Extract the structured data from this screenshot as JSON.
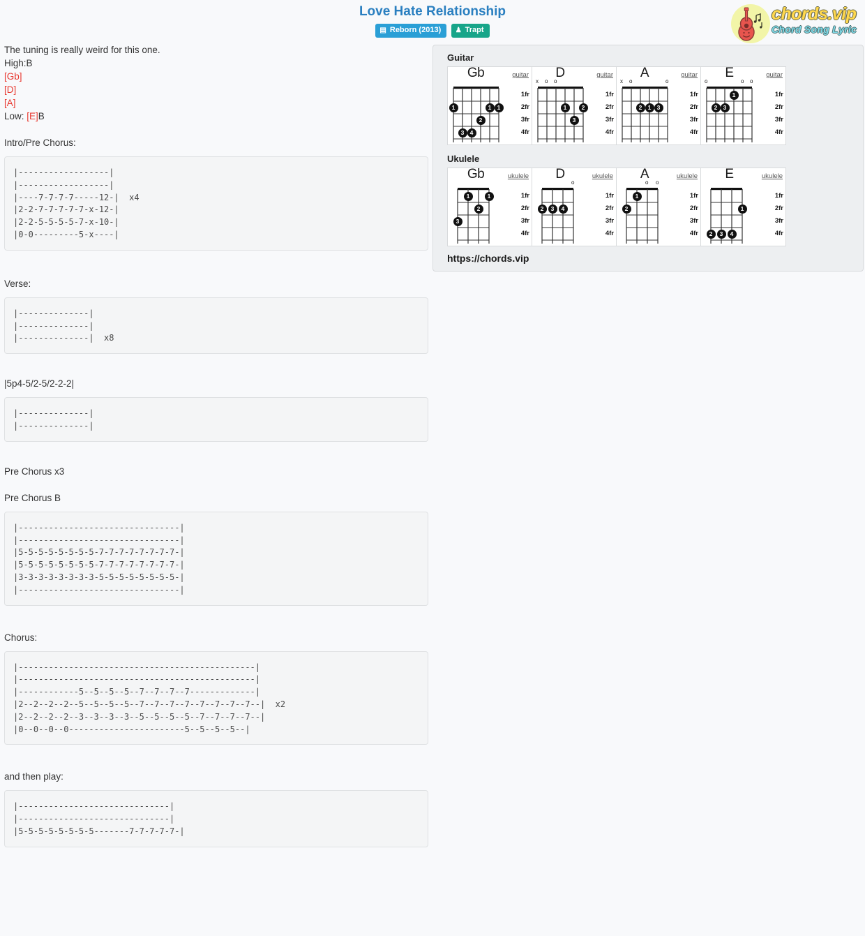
{
  "header": {
    "title": "Love Hate Relationship",
    "badges": [
      {
        "icon": "book-icon",
        "glyph": "▤",
        "label": "Reborn (2013)",
        "color": "#2a9fd6",
        "type": "album"
      },
      {
        "icon": "user-icon",
        "glyph": "♟",
        "label": "Trapt",
        "color": "#17a589",
        "type": "artist"
      }
    ]
  },
  "logo": {
    "icon": "guitar-icon",
    "main": "chords.vip",
    "sub": "Chord Song Lyric",
    "main_color": "#ffd84d",
    "sub_color": "#7fdcea",
    "disc_color": "#f2f5a8"
  },
  "body": {
    "intro_lines": [
      {
        "text": "The tuning is really weird for this one.",
        "chord": false
      },
      {
        "text": "High:B",
        "chord": false
      },
      {
        "text": "[Gb]",
        "chord": true
      },
      {
        "text": "[D]",
        "chord": true
      },
      {
        "text": "[A]",
        "chord": true
      },
      {
        "prefix": "Low: ",
        "chordpart": "[E]",
        "suffix": "B",
        "chord": "mixed"
      }
    ],
    "sections": [
      {
        "label": "Intro/Pre Chorus:",
        "tab": "|------------------|\n|------------------|\n|----7-7-7-7-----12-|  x4\n|2-2-7-7-7-7-7-x-12-|\n|2-2-5-5-5-5-7-x-10-|\n|0-0---------5-x----|"
      },
      {
        "label": "Verse:",
        "tab": "|--------------|\n|--------------|\n|--------------|  x8"
      },
      {
        "label": "|5p4-5/2-5/2-2-2|",
        "plain": true,
        "tab": "|--------------|\n|--------------|"
      },
      {
        "label": "Pre Chorus x3",
        "label2": "Pre Chorus B",
        "tab": "|--------------------------------|\n|--------------------------------|\n|5-5-5-5-5-5-5-5-7-7-7-7-7-7-7-7-|\n|5-5-5-5-5-5-5-5-7-7-7-7-7-7-7-7-|\n|3-3-3-3-3-3-3-3-5-5-5-5-5-5-5-5-|\n|--------------------------------|"
      },
      {
        "label": "Chorus:",
        "tab": "|-----------------------------------------------|\n|-----------------------------------------------|\n|------------5--5--5--5--7--7--7--7-------------|\n|2--2--2--2--5--5--5--5--7--7--7--7--7--7--7--7--|  x2\n|2--2--2--2--3--3--3--3--5--5--5--5--7--7--7--7--|\n|0--0--0--0-----------------------5--5--5--5--|"
      },
      {
        "label": "and then play:",
        "tab": "|------------------------------|\n|------------------------------|\n|5-5-5-5-5-5-5-5-------7-7-7-7-7-|"
      }
    ]
  },
  "chord_panel": {
    "guitar_title": "Guitar",
    "ukulele_title": "Ukulele",
    "site_link": "https://chords.vip",
    "fret_labels": [
      "1fr",
      "2fr",
      "3fr",
      "4fr"
    ],
    "guitar": [
      {
        "name": "Gb",
        "instrument": "guitar",
        "open": [],
        "muted": [],
        "dots": [
          {
            "string": 0,
            "fret": 2,
            "finger": "1"
          },
          {
            "string": 4,
            "fret": 2,
            "finger": "1"
          },
          {
            "string": 5,
            "fret": 2,
            "finger": "1"
          },
          {
            "string": 3,
            "fret": 3,
            "finger": "2"
          },
          {
            "string": 1,
            "fret": 4,
            "finger": "3"
          },
          {
            "string": 2,
            "fret": 4,
            "finger": "4"
          }
        ]
      },
      {
        "name": "D",
        "instrument": "guitar",
        "open": [
          1,
          2
        ],
        "muted": [
          0
        ],
        "dots": [
          {
            "string": 3,
            "fret": 2,
            "finger": "1"
          },
          {
            "string": 5,
            "fret": 2,
            "finger": "2"
          },
          {
            "string": 4,
            "fret": 3,
            "finger": "3"
          }
        ]
      },
      {
        "name": "A",
        "instrument": "guitar",
        "open": [
          1,
          5
        ],
        "muted": [
          0
        ],
        "dots": [
          {
            "string": 2,
            "fret": 2,
            "finger": "2"
          },
          {
            "string": 3,
            "fret": 2,
            "finger": "1"
          },
          {
            "string": 4,
            "fret": 2,
            "finger": "3"
          }
        ]
      },
      {
        "name": "E",
        "instrument": "guitar",
        "open": [
          0,
          4,
          5
        ],
        "muted": [],
        "dots": [
          {
            "string": 3,
            "fret": 1,
            "finger": "1"
          },
          {
            "string": 1,
            "fret": 2,
            "finger": "2"
          },
          {
            "string": 2,
            "fret": 2,
            "finger": "3"
          }
        ]
      }
    ],
    "ukulele": [
      {
        "name": "Gb",
        "instrument": "ukulele",
        "open": [],
        "muted": [],
        "dots": [
          {
            "string": 1,
            "fret": 1,
            "finger": "1"
          },
          {
            "string": 3,
            "fret": 1,
            "finger": "1"
          },
          {
            "string": 2,
            "fret": 2,
            "finger": "2"
          },
          {
            "string": 0,
            "fret": 3,
            "finger": "3"
          }
        ]
      },
      {
        "name": "D",
        "instrument": "ukulele",
        "open": [
          3
        ],
        "muted": [],
        "dots": [
          {
            "string": 0,
            "fret": 2,
            "finger": "2"
          },
          {
            "string": 1,
            "fret": 2,
            "finger": "3"
          },
          {
            "string": 2,
            "fret": 2,
            "finger": "4"
          }
        ]
      },
      {
        "name": "A",
        "instrument": "ukulele",
        "open": [
          2,
          3
        ],
        "muted": [],
        "dots": [
          {
            "string": 1,
            "fret": 1,
            "finger": "1"
          },
          {
            "string": 0,
            "fret": 2,
            "finger": "2"
          }
        ]
      },
      {
        "name": "E",
        "instrument": "ukulele",
        "open": [],
        "muted": [],
        "dots": [
          {
            "string": 3,
            "fret": 2,
            "finger": "1"
          },
          {
            "string": 0,
            "fret": 4,
            "finger": "2"
          },
          {
            "string": 1,
            "fret": 4,
            "finger": "3"
          },
          {
            "string": 2,
            "fret": 4,
            "finger": "4"
          }
        ]
      }
    ]
  }
}
